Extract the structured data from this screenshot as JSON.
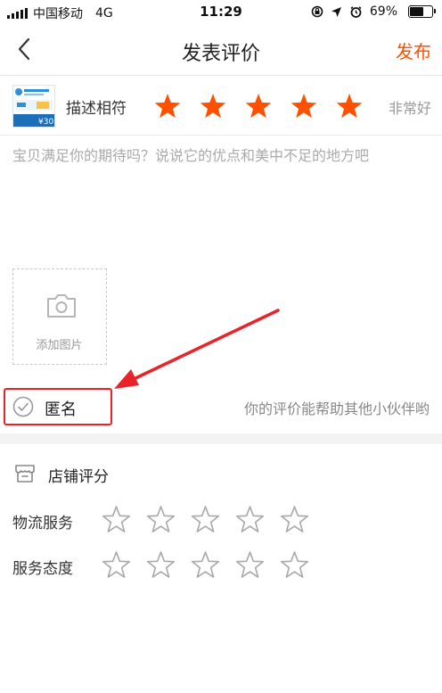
{
  "status_bar": {
    "carrier": "中国移动",
    "network": "4G",
    "time": "11:29",
    "battery": "69%",
    "battery_level": 0.69
  },
  "nav": {
    "title": "发表评价",
    "publish_label": "发布",
    "accent_color": "#ff5000"
  },
  "product": {
    "thumbnail_text": "¥30",
    "rating_label": "描述相符",
    "rating_value": 5,
    "rating_max": 5,
    "rating_text": "非常好",
    "star_color": "#ff5000"
  },
  "comment": {
    "placeholder": "宝贝满足你的期待吗？说说它的优点和美中不足的地方吧",
    "value": ""
  },
  "photo": {
    "label": "添加图片"
  },
  "anonymous": {
    "label": "匿名",
    "hint": "你的评价能帮助其他小伙伴哟",
    "annotation_color": "#e8242a"
  },
  "shop_rating": {
    "title": "店铺评分",
    "rows": [
      {
        "label": "物流服务",
        "value": 0,
        "max": 5
      },
      {
        "label": "服务态度",
        "value": 0,
        "max": 5
      }
    ]
  }
}
